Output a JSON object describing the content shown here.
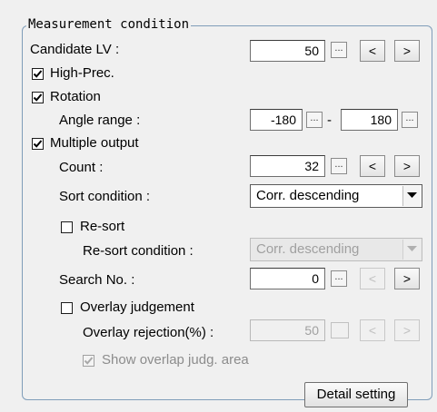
{
  "group": {
    "title": "Measurement condition"
  },
  "candidate_lv": {
    "label": "Candidate LV :",
    "value": "50",
    "ellipsis": "...",
    "prev": "<",
    "next": ">"
  },
  "high_prec": {
    "label": "High-Prec.",
    "checked": true
  },
  "rotation": {
    "label": "Rotation",
    "checked": true,
    "angle_label": "Angle range :",
    "min": "-180",
    "max": "180",
    "dash": "-",
    "ellipsis": "..."
  },
  "multiple_output": {
    "label": "Multiple output",
    "checked": true
  },
  "count": {
    "label": "Count :",
    "value": "32",
    "ellipsis": "...",
    "prev": "<",
    "next": ">"
  },
  "sort": {
    "label": "Sort condition :",
    "value": "Corr. descending"
  },
  "re_sort": {
    "label": "Re-sort",
    "checked": false,
    "condition_label": "Re-sort condition :",
    "condition_value": "Corr. descending"
  },
  "search_no": {
    "label": "Search No. :",
    "value": "0",
    "ellipsis": "...",
    "prev": "<",
    "next": ">"
  },
  "overlay": {
    "label": "Overlay judgement",
    "checked": false,
    "rejection_label": "Overlay rejection(%) :",
    "rejection_value": "50",
    "prev": "<",
    "next": ">",
    "show_area_label": "Show overlap judg. area",
    "show_area_checked": true
  },
  "buttons": {
    "detail_setting": "Detail setting"
  }
}
